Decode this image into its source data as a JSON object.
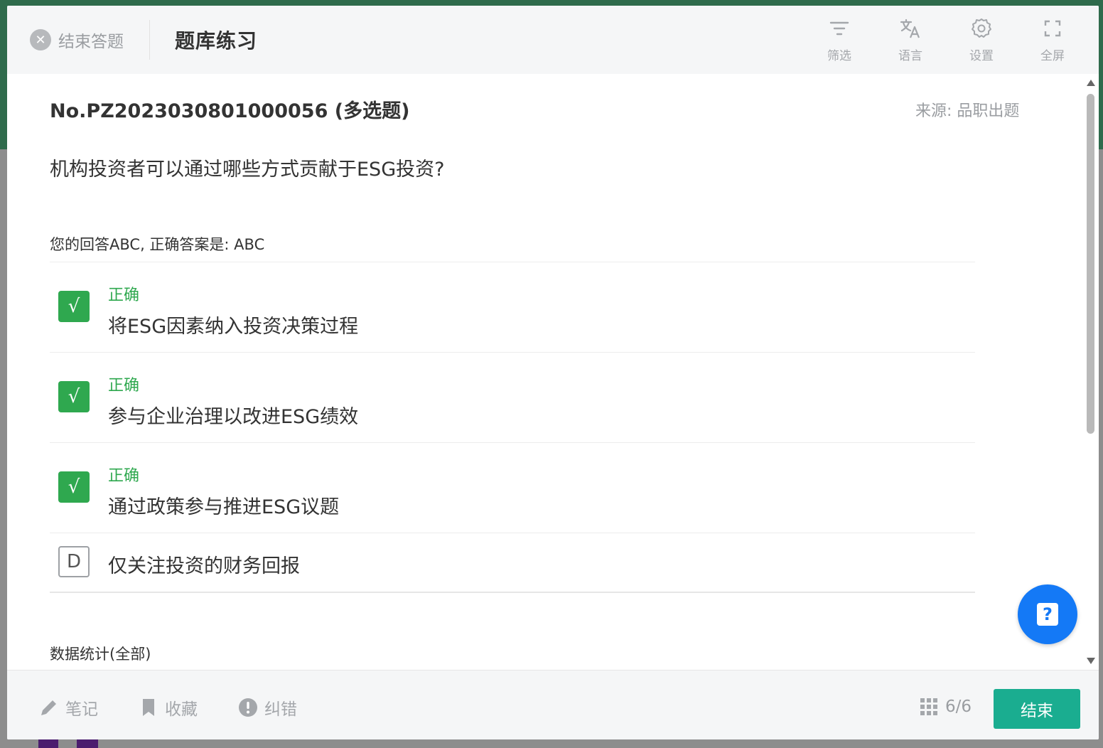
{
  "header": {
    "exit_label": "结束答题",
    "title": "题库练习",
    "tools": [
      {
        "label": "筛选",
        "icon": "filter-icon"
      },
      {
        "label": "语言",
        "icon": "translate-icon"
      },
      {
        "label": "设置",
        "icon": "gear-icon"
      },
      {
        "label": "全屏",
        "icon": "fullscreen-icon"
      }
    ]
  },
  "question": {
    "number": "No.PZ2023030801000056 (多选题)",
    "source": "来源: 品职出题",
    "text": "机构投资者可以通过哪些方式贡献于ESG投资?",
    "answer_summary": "您的回答ABC, 正确答案是: ABC",
    "options": [
      {
        "marker": "√",
        "status": "正确",
        "text": "将ESG因素纳入投资决策过程",
        "correct": true
      },
      {
        "marker": "√",
        "status": "正确",
        "text": "参与企业治理以改进ESG绩效",
        "correct": true
      },
      {
        "marker": "√",
        "status": "正确",
        "text": "通过政策参与推进ESG议题",
        "correct": true
      },
      {
        "marker": "D",
        "status": "",
        "text": "仅关注投资的财务回报",
        "correct": false
      }
    ],
    "stats_title": "数据统计(全部)"
  },
  "help": {
    "label": "?"
  },
  "footer": {
    "note_label": "笔记",
    "favorite_label": "收藏",
    "report_label": "纠错",
    "progress": "6/6",
    "finish_label": "结束"
  },
  "colors": {
    "correct": "#2fa84f",
    "finish": "#1aad90",
    "help": "#1479f6"
  }
}
